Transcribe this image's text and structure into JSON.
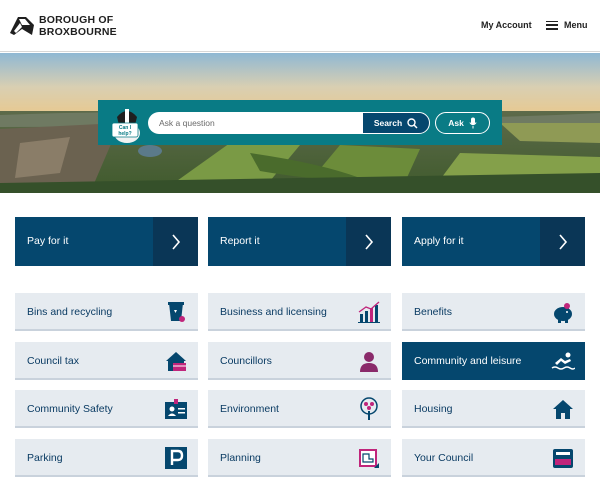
{
  "header": {
    "logo_line1": "BOROUGH OF",
    "logo_line2": "BROXBOURNE",
    "my_account": "My Account",
    "menu_label": "Menu"
  },
  "search": {
    "badge_text": "Can I help?",
    "placeholder": "Ask a question",
    "search_label": "Search",
    "ask_label": "Ask"
  },
  "actions": [
    {
      "label": "Pay for it"
    },
    {
      "label": "Report it"
    },
    {
      "label": "Apply for it"
    }
  ],
  "services": [
    {
      "label": "Bins and recycling",
      "icon": "bin-icon"
    },
    {
      "label": "Business and licensing",
      "icon": "bar-chart-icon"
    },
    {
      "label": "Benefits",
      "icon": "piggy-bank-icon"
    },
    {
      "label": "Council tax",
      "icon": "house-card-icon"
    },
    {
      "label": "Councillors",
      "icon": "person-icon"
    },
    {
      "label": "Community and leisure",
      "icon": "swimmer-icon",
      "active": true
    },
    {
      "label": "Community Safety",
      "icon": "id-badge-icon"
    },
    {
      "label": "Environment",
      "icon": "tree-icon"
    },
    {
      "label": "Housing",
      "icon": "house-icon"
    },
    {
      "label": "Parking",
      "icon": "parking-icon"
    },
    {
      "label": "Planning",
      "icon": "blueprint-icon"
    },
    {
      "label": "Your Council",
      "icon": "ballot-box-icon"
    }
  ],
  "colors": {
    "primary": "#05476e",
    "teal": "#097b85",
    "magenta": "#c0257b",
    "tile_bg": "#e6ebf0"
  }
}
